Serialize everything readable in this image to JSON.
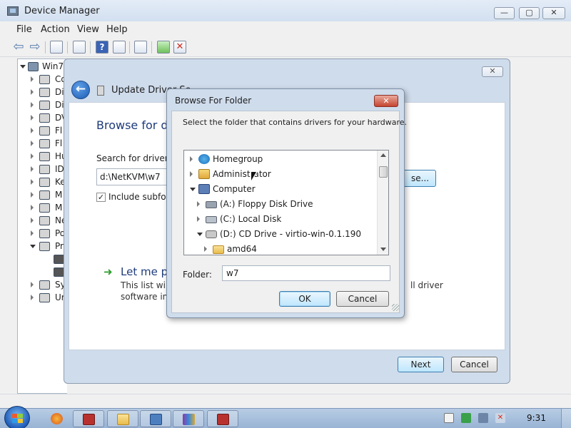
{
  "device_manager": {
    "title": "Device Manager",
    "caption_buttons": {
      "minimize": "—",
      "maximize": "▢",
      "close": "✕"
    },
    "menu": [
      "File",
      "Action",
      "View",
      "Help"
    ],
    "tree": {
      "root": "Win7-",
      "items": [
        "Co",
        "Di",
        "Di",
        "DV",
        "Fl",
        "Fl",
        "Hu",
        "ID",
        "Ke",
        "M",
        "M",
        "Ne",
        "Po",
        "Pr",
        "",
        "",
        "Sy",
        "Ur"
      ]
    }
  },
  "wizard": {
    "title": "Update Driver So",
    "close": "✕",
    "back": "←",
    "heading": "Browse for dri",
    "search_label": "Search for driver so",
    "path_value": "d:\\NetKVM\\w7",
    "browse_label": "se...",
    "include_subfolders": "Include subfold",
    "include_subfolders_checked": "✓",
    "let_me_arrow": "➜",
    "let_me": "Let me pi",
    "let_me_desc_line1": "This list will s",
    "let_me_desc_line2": "software in t",
    "right_text_line1": "ll driver",
    "right_text_line2": "",
    "next": "Next",
    "cancel": "Cancel"
  },
  "browse_dialog": {
    "title": "Browse For Folder",
    "close": "✕",
    "instruction": "Select the folder that contains drivers for your hardware.",
    "folders": [
      {
        "label": "Homegroup",
        "icon": "homegroup-icon",
        "level": 0,
        "expanded": false
      },
      {
        "label": "Administrator",
        "icon": "user-folder-icon",
        "level": 0,
        "expanded": false
      },
      {
        "label": "Computer",
        "icon": "computer-icon",
        "level": 0,
        "expanded": true
      },
      {
        "label": "(A:) Floppy Disk Drive",
        "icon": "floppy-drive-icon",
        "level": 1,
        "expanded": false
      },
      {
        "label": "(C:) Local Disk",
        "icon": "local-disk-icon",
        "level": 1,
        "expanded": false
      },
      {
        "label": "(D:) CD Drive - virtio-win-0.1.190",
        "icon": "cd-drive-icon",
        "level": 1,
        "expanded": true
      },
      {
        "label": "amd64",
        "icon": "folder-icon",
        "level": 2,
        "expanded": false
      }
    ],
    "folder_label": "Folder:",
    "folder_value": "w7",
    "ok": "OK",
    "cancel": "Cancel"
  },
  "taskbar": {
    "clock": "9:31",
    "apps": [
      "firefox",
      "device-manager",
      "explorer",
      "remote-desktop",
      "winrar",
      "device-manager-2"
    ]
  },
  "colors": {
    "accent_blue": "#1e3b7a",
    "default_button": "#bee6fd",
    "close_red": "#c5442f"
  }
}
